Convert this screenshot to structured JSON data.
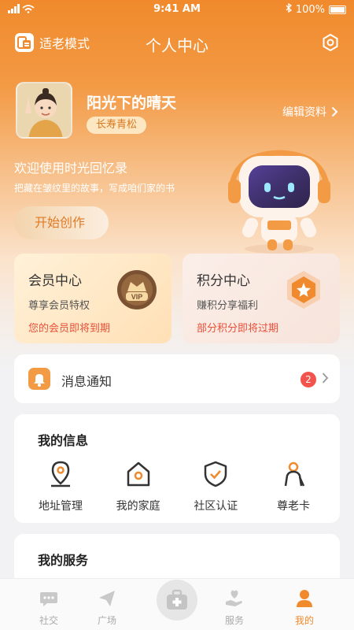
{
  "status_bar": {
    "time": "9:41 AM",
    "battery": "100%"
  },
  "header": {
    "elder_mode_label": "适老模式",
    "title": "个人中心"
  },
  "profile": {
    "name": "阳光下的晴天",
    "level": "长寿青松",
    "edit_label": "编辑资料"
  },
  "welcome": {
    "title": "欢迎使用时光回忆录",
    "subtitle": "把藏在皱纹里的故事，写成咱们家的书",
    "start_button": "开始创作"
  },
  "vip_card": {
    "title": "会员中心",
    "subtitle": "尊享会员特权",
    "warning": "您的会员即将到期",
    "badge_text": "VIP"
  },
  "points_card": {
    "title": "积分中心",
    "subtitle": "赚积分享福利",
    "warning": "部分积分即将过期"
  },
  "notification": {
    "label": "消息通知",
    "count": "2"
  },
  "my_info": {
    "title": "我的信息",
    "items": [
      {
        "label": "地址管理",
        "icon": "location-pin-icon"
      },
      {
        "label": "我的家庭",
        "icon": "home-icon"
      },
      {
        "label": "社区认证",
        "icon": "shield-check-icon"
      },
      {
        "label": "尊老卡",
        "icon": "elder-card-icon"
      }
    ]
  },
  "my_services": {
    "title": "我的服务"
  },
  "tabs": [
    {
      "label": "社交",
      "icon": "chat-bubble-icon"
    },
    {
      "label": "广场",
      "icon": "paper-plane-icon"
    },
    {
      "label": "",
      "icon": "medical-kit-icon"
    },
    {
      "label": "服务",
      "icon": "heart-hand-icon"
    },
    {
      "label": "我的",
      "icon": "person-icon"
    }
  ],
  "colors": {
    "accent": "#f08a2c",
    "warning": "#e8503a",
    "badge": "#f2544d"
  }
}
